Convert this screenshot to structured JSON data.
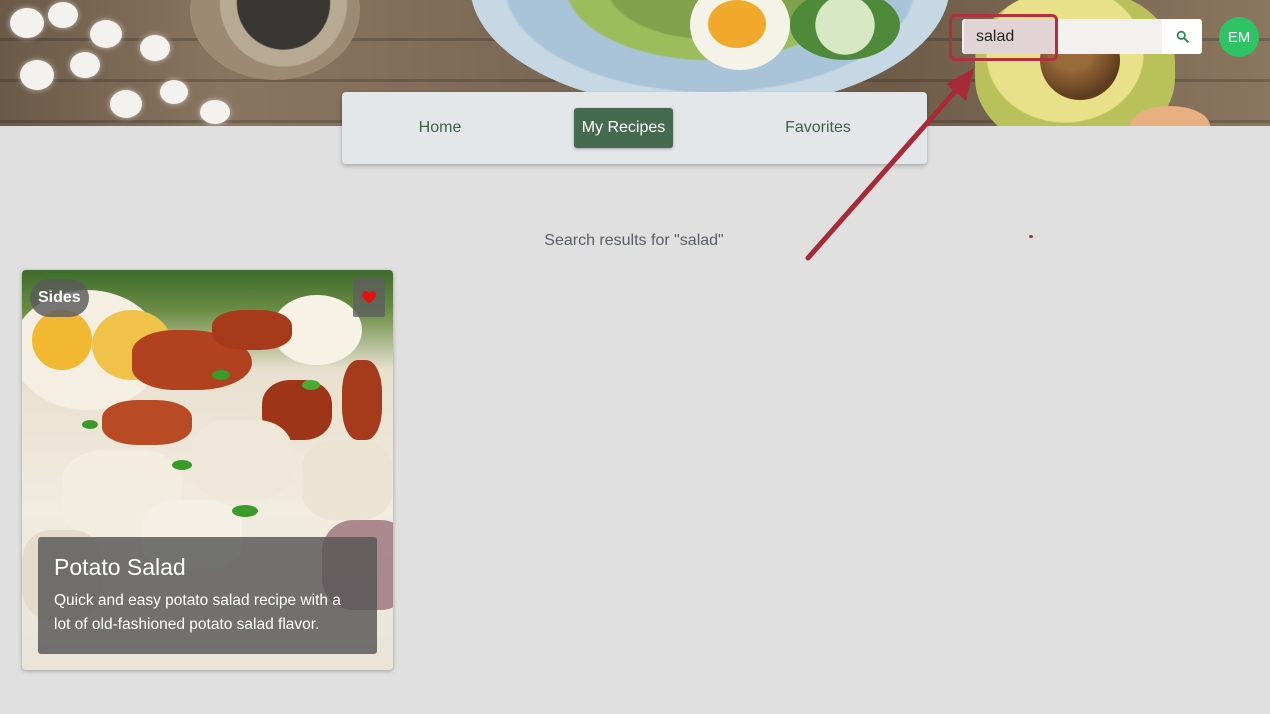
{
  "header": {
    "search": {
      "value": "salad",
      "placeholder": ""
    },
    "search_button_icon": "search-icon",
    "avatar_initials": "EM"
  },
  "nav": {
    "items": [
      {
        "label": "Home",
        "active": false
      },
      {
        "label": "My Recipes",
        "active": true
      },
      {
        "label": "Favorites",
        "active": false
      }
    ]
  },
  "main": {
    "results_heading": "Search results for \"salad\"",
    "recipes": [
      {
        "category": "Sides",
        "title": "Potato Salad",
        "description": "Quick and easy potato salad recipe with a lot of old-fashioned potato salad flavor.",
        "favorite": true,
        "favorite_icon": "heart-icon"
      }
    ]
  },
  "colors": {
    "background": "#e0e0e0",
    "nav_active": "#466a50",
    "avatar": "#2ec466",
    "annotation": "#b0303f",
    "heart": "#e01010"
  }
}
